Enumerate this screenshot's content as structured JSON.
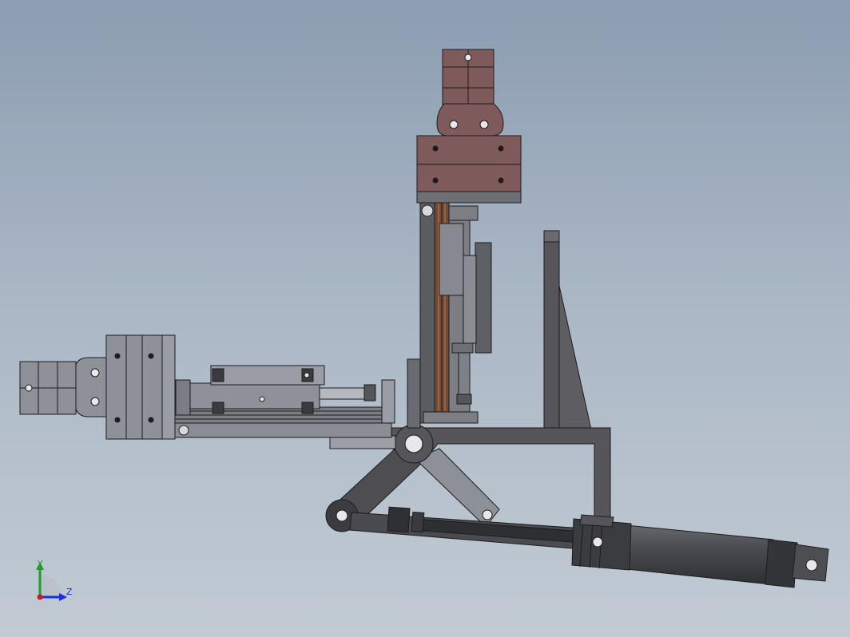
{
  "triad": {
    "y_label": "Y",
    "z_label": "Z",
    "y_color": "#1f9d2a",
    "z_color": "#1d2fd6",
    "origin_color": "#c8192a"
  },
  "colors": {
    "background_top": "#8c9db1",
    "background_bottom": "#c2cbd4",
    "gripper_brown": "#7f5a5a",
    "frame_dark": "#545458",
    "part_gray": "#8a8d94",
    "edge": "#1c1c1e"
  }
}
